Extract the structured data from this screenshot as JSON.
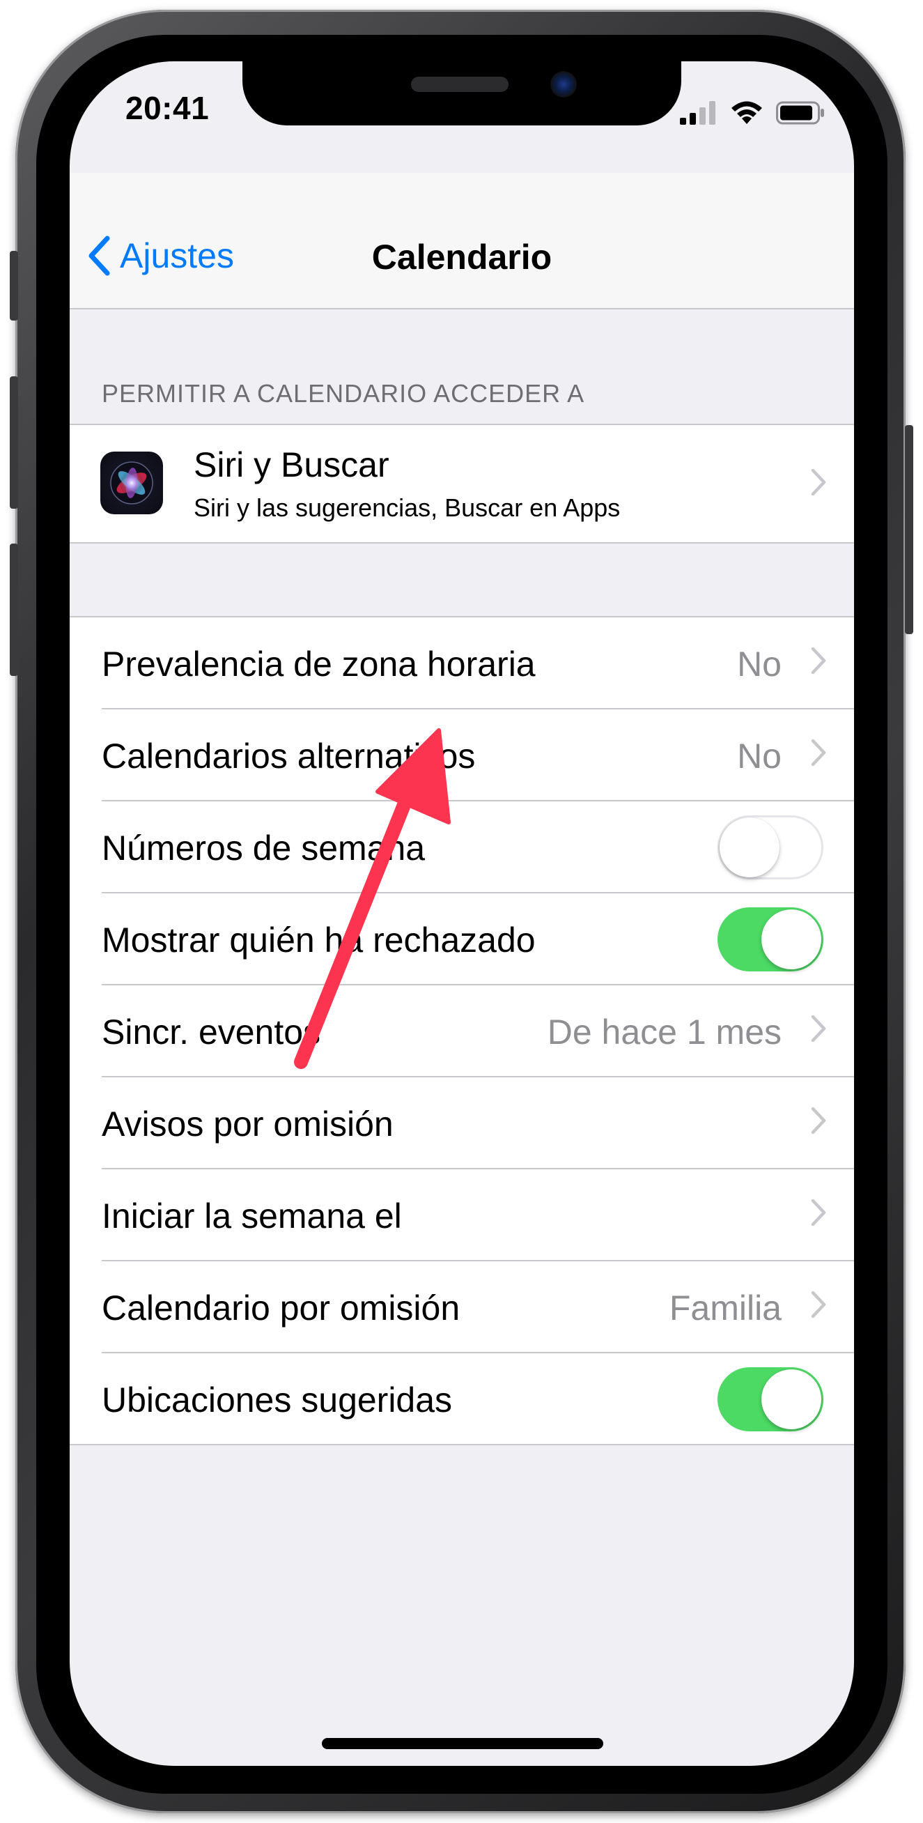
{
  "status_bar": {
    "time": "20:41",
    "icons": [
      "cellular-signal-icon",
      "wifi-icon",
      "battery-icon"
    ]
  },
  "nav": {
    "back_label": "Ajustes",
    "title": "Calendario"
  },
  "access_section": {
    "header": "PERMITIR A CALENDARIO ACCEDER A",
    "siri": {
      "title": "Siri y Buscar",
      "subtitle": "Siri y las sugerencias, Buscar en Apps",
      "icon": "siri-icon"
    }
  },
  "settings": {
    "rows": [
      {
        "label": "Prevalencia de zona horaria",
        "value": "No",
        "type": "disclosure"
      },
      {
        "label": "Calendarios alternativos",
        "value": "No",
        "type": "disclosure"
      },
      {
        "label": "Números de semana",
        "type": "toggle",
        "on": false
      },
      {
        "label": "Mostrar quién ha rechazado",
        "type": "toggle",
        "on": true
      },
      {
        "label": "Sincr. eventos",
        "value": "De hace 1 mes",
        "type": "disclosure"
      },
      {
        "label": "Avisos por omisión",
        "value": "",
        "type": "disclosure"
      },
      {
        "label": "Iniciar la semana el",
        "value": "",
        "type": "disclosure"
      },
      {
        "label": "Calendario por omisión",
        "value": "Familia",
        "type": "disclosure"
      },
      {
        "label": "Ubicaciones sugeridas",
        "type": "toggle",
        "on": true
      }
    ]
  },
  "colors": {
    "accent": "#007aff",
    "toggle_on": "#4cd964",
    "annotation_arrow": "#fc3450",
    "grouped_background": "#efeff4"
  }
}
